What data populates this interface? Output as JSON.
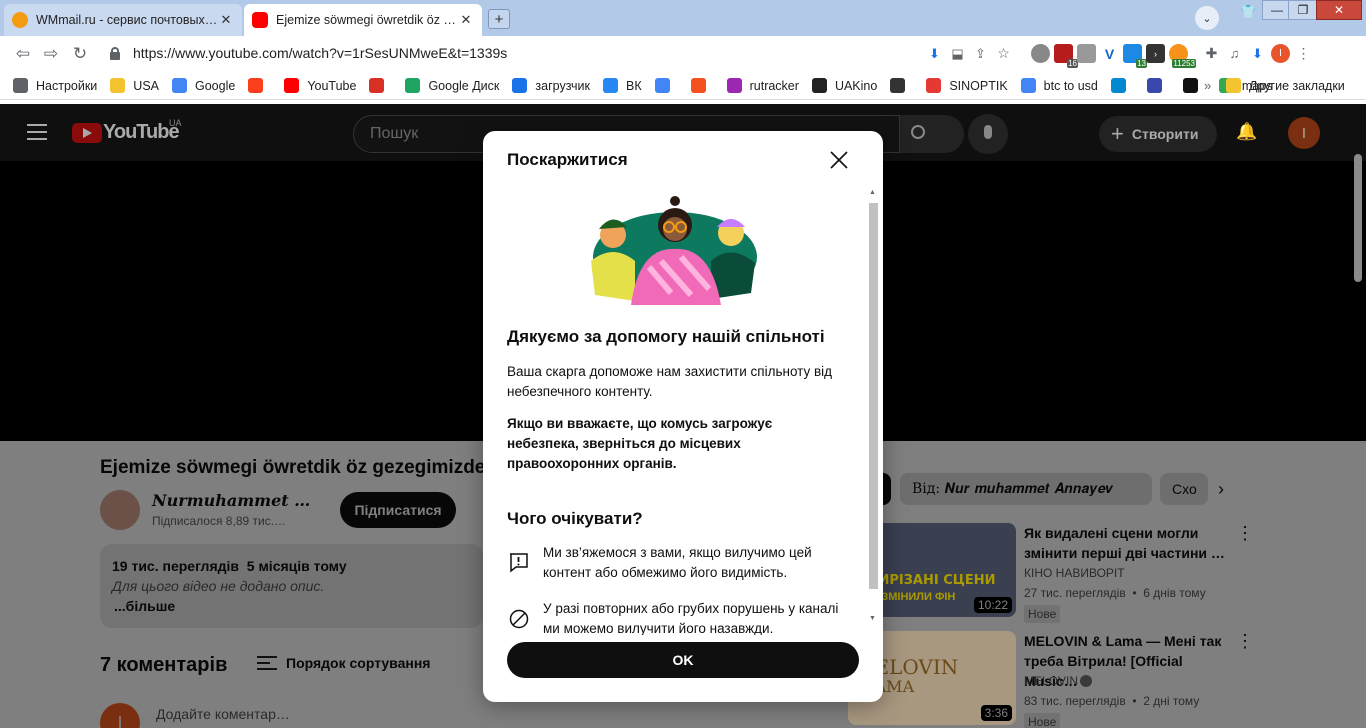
{
  "browser": {
    "tabs": [
      {
        "title": "WMmail.ru - сервис почтовых рас",
        "close": "✕",
        "active": false
      },
      {
        "title": "Ejemize söwmegi öwretdik öz geze",
        "close": "✕",
        "active": true
      }
    ],
    "new_tab": "+",
    "window_controls": {
      "minimize": "—",
      "maximize": "❐",
      "close": "✕"
    },
    "url": "https://www.youtube.com/watch?v=1rSesUNMweE&t=1339s",
    "extension_badges": {
      "ext1": "16",
      "ext2": "13",
      "ext3": "11253"
    },
    "profile_initial": "I",
    "bookmarks": [
      {
        "label": "Настройки",
        "icon": "gear-icon",
        "color": "#5f6368"
      },
      {
        "label": "USA",
        "icon": "folder-icon",
        "color": "#f4c430"
      },
      {
        "label": "Google",
        "icon": "google-icon",
        "color": "#4285f4"
      },
      {
        "label": "",
        "icon": "yandex-icon",
        "color": "#fc3f1d"
      },
      {
        "label": "YouTube",
        "icon": "youtube-icon",
        "color": "#ff0000"
      },
      {
        "label": "",
        "icon": "gmail-icon",
        "color": "#d93025"
      },
      {
        "label": "Google Диск",
        "icon": "drive-icon",
        "color": "#1fa463"
      },
      {
        "label": "загрузчик",
        "icon": "loader-icon",
        "color": "#1a73e8"
      },
      {
        "label": "ВК",
        "icon": "vk-icon",
        "color": "#2787f5"
      },
      {
        "label": "",
        "icon": "translate-icon",
        "color": "#4285f4"
      },
      {
        "label": "",
        "icon": "f-icon",
        "color": "#f4511e"
      },
      {
        "label": "rutracker",
        "icon": "rutracker-icon",
        "color": "#9c27b0"
      },
      {
        "label": "UAKino",
        "icon": "uakino-icon",
        "color": "#222222"
      },
      {
        "label": "",
        "icon": "chess-icon",
        "color": "#333333"
      },
      {
        "label": "SINOPTIK",
        "icon": "thermometer-icon",
        "color": "#e53935"
      },
      {
        "label": "btc to usd",
        "icon": "google-icon",
        "color": "#4285f4"
      },
      {
        "label": "",
        "icon": "p-icon",
        "color": "#0288d1"
      },
      {
        "label": "",
        "icon": "arrow-icon",
        "color": "#3949ab"
      },
      {
        "label": "",
        "icon": "bc-icon",
        "color": "#111111"
      },
      {
        "label": "maps",
        "icon": "maps-icon",
        "color": "#34a853"
      }
    ],
    "bookmarks_more": "»",
    "other_bookmarks": "Другие закладки"
  },
  "youtube": {
    "logo_text": "YouTube",
    "region": "UA",
    "search_placeholder": "Пошук",
    "create_label": "Створити",
    "avatar_initial": "I",
    "video_title": "Ejemize söwmegi öwretdik öz gezegimizde",
    "channel_name": "𝑵𝒖𝒓𝒎𝒖𝒉𝒂𝒎𝒎𝒆𝒕 …",
    "subscribers": "Підписалося 8,89 тис.…",
    "subscribe_label": "Підписатися",
    "description": {
      "stats": "19 тис. переглядів  5 місяців тому",
      "text": "Для цього відео не додано опис.",
      "more": "...більше"
    },
    "comments_count": "7 коментарів",
    "sort_label": "Порядок сортування",
    "add_comment_placeholder": "Додайте коментар…",
    "chips": [
      {
        "label": "Від: 𝑵𝒖𝒓 𝒎𝒖𝒉𝒂𝒎𝒎𝒆𝒕 𝑨𝒏𝒏𝒂𝒚𝒆𝒗"
      },
      {
        "label": "Схо"
      }
    ],
    "related": [
      {
        "title": "Як видалені сцени могли змінити перші дві частини …",
        "channel": "КІНО НАВИВОРІТ",
        "meta": "27 тис. переглядів  •  6 днів тому",
        "badge": "Нове",
        "duration": "10:22",
        "thumb_text_1": "ВИРІЗАНІ СЦЕНИ",
        "thumb_text_2": "ЯКІ ЗМІНИЛИ ФІН"
      },
      {
        "title": "MELOVIN & Lama — Мені так треба Вітрила! [Official Music…",
        "channel": "MELOVIN",
        "meta": "83 тис. переглядів  •  2 дні тому",
        "badge": "Нове",
        "duration": "3:36",
        "thumb_text_1": "MELOVIN",
        "thumb_text_2": "LAMA"
      }
    ]
  },
  "dialog": {
    "title": "Поскаржитися",
    "heading": "Дякуємо за допомогу нашій спільноті",
    "para1": "Ваша скарга допоможе нам захистити спільноту від небезпечного контенту.",
    "para2": "Якщо ви вважаєте, що комусь загрожує небезпека, зверніться до місцевих правоохоронних органів.",
    "subheading": "Чого очікувати?",
    "item1": "Ми зв’яжемося з вами, якщо вилучимо цей контент або обмежимо його видимість.",
    "item2": "У разі повторних або грубих порушень у каналі ми можемо вилучити його назавжди.",
    "ok_label": "OK"
  }
}
